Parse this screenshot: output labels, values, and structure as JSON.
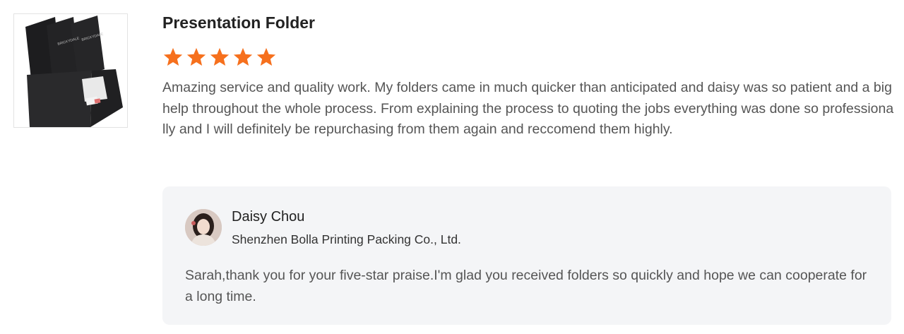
{
  "review": {
    "product_image_label": "BRICKYDALE",
    "title": "Presentation Folder",
    "rating": 5,
    "rating_max": 5,
    "star_color": "#f6701d",
    "text": "Amazing service and quality work. My folders came in much quicker than anticipated and daisy was so patient and a big help throughout the whole process. From explaining the process to quoting the jobs everything was done so professionally and I will definitely be repurchasing from them again and reccomend them highly."
  },
  "reply": {
    "name": "Daisy Chou",
    "company": "Shenzhen Bolla Printing Packing Co., Ltd.",
    "text": "Sarah,thank you for your five-star praise.I'm glad you received folders so quickly and hope we can cooperate for a long time."
  }
}
